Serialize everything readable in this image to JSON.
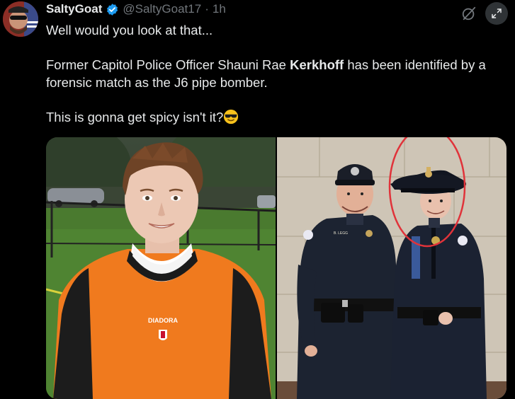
{
  "tweet": {
    "display_name": "SaltyGoat",
    "handle": "@SaltyGoat17",
    "separator": "·",
    "time": "1h",
    "line1": "Well would you look at that...",
    "line2_pre": "Former Capitol Police Officer Shauni Rae ",
    "line2_bold": "Kerkhoff",
    "line2_post": " has been identified by a forensic match as the J6 pipe bomber.",
    "line3": "This is gonna get spicy isn't it?",
    "emoji_name": "smiling-face-with-sunglasses-icon"
  },
  "media": {
    "left_photo": {
      "name": "soccer-goalkeeper-portrait",
      "jersey_text": "DIADORA"
    },
    "right_photo": {
      "name": "two-police-officers-photo",
      "badge_text": "B. LEGG"
    }
  },
  "icons": {
    "verified": "verified-badge-icon",
    "grok": "grok-icon",
    "expand": "expand-icon"
  },
  "colors": {
    "background": "#000000",
    "text": "#e7e9ea",
    "muted": "#71767b",
    "verified_blue": "#1d9bf0",
    "annotation_red": "#e0333a"
  }
}
